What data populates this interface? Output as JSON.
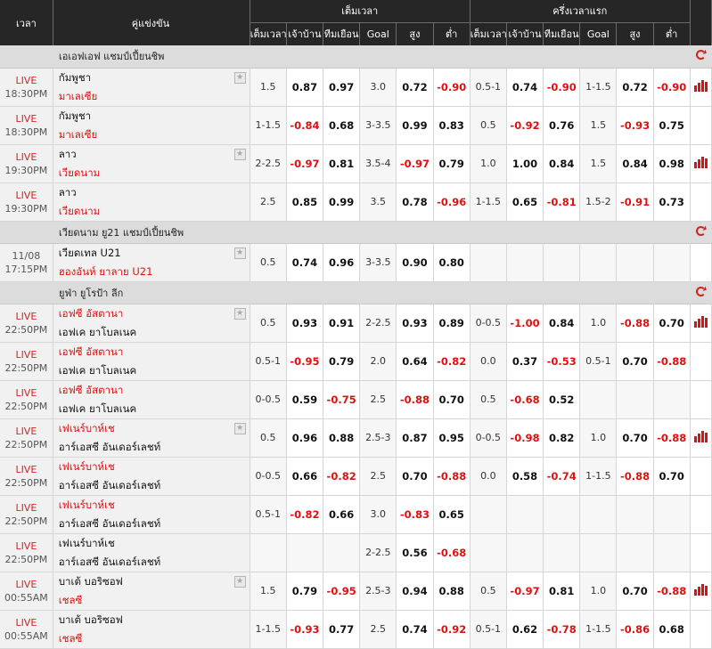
{
  "header": {
    "time": "เวลา",
    "match": "คู่แข่งขัน",
    "fulltime": "เต็มเวลา",
    "firsthalf": "ครึ่งเวลาแรก",
    "sub": [
      "เต็มเวลา",
      "เจ้าบ้าน",
      "ทีมเยือน",
      "Goal",
      "สูง",
      "ต่ำ",
      "เต็มเวลา",
      "เจ้าบ้าน",
      "ทีมเยือน",
      "Goal",
      "สูง",
      "ต่ำ"
    ]
  },
  "leagues": [
    {
      "name": "เอเอฟเอฟ แชมป์เปี้ยนชิพ",
      "rows": [
        {
          "status": "LIVE",
          "time": "18:30PM",
          "home": "กัมพูชา",
          "home_color": "black",
          "away": "มาเลเซีย",
          "away_color": "red",
          "star": true,
          "chart": true,
          "ft": [
            "1.5",
            "0.87",
            "0.97",
            "3.0",
            "0.72",
            "-0.90"
          ],
          "fh": [
            "0.5-1",
            "0.74",
            "-0.90",
            "1-1.5",
            "0.72",
            "-0.90"
          ]
        },
        {
          "status": "LIVE",
          "time": "18:30PM",
          "home": "กัมพูชา",
          "home_color": "black",
          "away": "มาเลเซีย",
          "away_color": "red",
          "star": false,
          "chart": false,
          "ft": [
            "1-1.5",
            "-0.84",
            "0.68",
            "3-3.5",
            "0.99",
            "0.83"
          ],
          "fh": [
            "0.5",
            "-0.92",
            "0.76",
            "1.5",
            "-0.93",
            "0.75"
          ]
        },
        {
          "status": "LIVE",
          "time": "19:30PM",
          "home": "ลาว",
          "home_color": "black",
          "away": "เวียดนาม",
          "away_color": "red",
          "star": true,
          "chart": true,
          "ft": [
            "2-2.5",
            "-0.97",
            "0.81",
            "3.5-4",
            "-0.97",
            "0.79"
          ],
          "fh": [
            "1.0",
            "1.00",
            "0.84",
            "1.5",
            "0.84",
            "0.98"
          ]
        },
        {
          "status": "LIVE",
          "time": "19:30PM",
          "home": "ลาว",
          "home_color": "black",
          "away": "เวียดนาม",
          "away_color": "red",
          "star": false,
          "chart": false,
          "ft": [
            "2.5",
            "0.85",
            "0.99",
            "3.5",
            "0.78",
            "-0.96"
          ],
          "fh": [
            "1-1.5",
            "0.65",
            "-0.81",
            "1.5-2",
            "-0.91",
            "0.73"
          ]
        }
      ]
    },
    {
      "name": "เวียดนาม ยู21 แชมป์เปี้ยนชิพ",
      "rows": [
        {
          "status": "11/08",
          "time": "17:15PM",
          "home": "เวียดเทล U21",
          "home_color": "black",
          "away": "ฮองอันห์ ยาลาย U21",
          "away_color": "red",
          "star": true,
          "chart": false,
          "ft": [
            "0.5",
            "0.74",
            "0.96",
            "3-3.5",
            "0.90",
            "0.80"
          ],
          "fh": [
            "",
            "",
            "",
            "",
            "",
            ""
          ]
        }
      ]
    },
    {
      "name": "ยูฟ่า ยูโรป้า ลีก",
      "rows": [
        {
          "status": "LIVE",
          "time": "22:50PM",
          "home": "เอฟซี อัสตานา",
          "home_color": "red",
          "away": "เอฟเค ยาโบลเนค",
          "away_color": "black",
          "star": true,
          "chart": true,
          "ft": [
            "0.5",
            "0.93",
            "0.91",
            "2-2.5",
            "0.93",
            "0.89"
          ],
          "fh": [
            "0-0.5",
            "-1.00",
            "0.84",
            "1.0",
            "-0.88",
            "0.70"
          ]
        },
        {
          "status": "LIVE",
          "time": "22:50PM",
          "home": "เอฟซี อัสตานา",
          "home_color": "red",
          "away": "เอฟเค ยาโบลเนค",
          "away_color": "black",
          "star": false,
          "chart": false,
          "ft": [
            "0.5-1",
            "-0.95",
            "0.79",
            "2.0",
            "0.64",
            "-0.82"
          ],
          "fh": [
            "0.0",
            "0.37",
            "-0.53",
            "0.5-1",
            "0.70",
            "-0.88"
          ]
        },
        {
          "status": "LIVE",
          "time": "22:50PM",
          "home": "เอฟซี อัสตานา",
          "home_color": "red",
          "away": "เอฟเค ยาโบลเนค",
          "away_color": "black",
          "star": false,
          "chart": false,
          "ft": [
            "0-0.5",
            "0.59",
            "-0.75",
            "2.5",
            "-0.88",
            "0.70"
          ],
          "fh": [
            "0.5",
            "-0.68",
            "0.52",
            "",
            "",
            ""
          ]
        },
        {
          "status": "LIVE",
          "time": "22:50PM",
          "home": "เฟเนร์บาห์เช",
          "home_color": "red",
          "away": "อาร์เอสซี อันเดอร์เลชท์",
          "away_color": "black",
          "star": true,
          "chart": true,
          "ft": [
            "0.5",
            "0.96",
            "0.88",
            "2.5-3",
            "0.87",
            "0.95"
          ],
          "fh": [
            "0-0.5",
            "-0.98",
            "0.82",
            "1.0",
            "0.70",
            "-0.88"
          ]
        },
        {
          "status": "LIVE",
          "time": "22:50PM",
          "home": "เฟเนร์บาห์เช",
          "home_color": "red",
          "away": "อาร์เอสซี อันเดอร์เลชท์",
          "away_color": "black",
          "star": false,
          "chart": false,
          "ft": [
            "0-0.5",
            "0.66",
            "-0.82",
            "2.5",
            "0.70",
            "-0.88"
          ],
          "fh": [
            "0.0",
            "0.58",
            "-0.74",
            "1-1.5",
            "-0.88",
            "0.70"
          ]
        },
        {
          "status": "LIVE",
          "time": "22:50PM",
          "home": "เฟเนร์บาห์เช",
          "home_color": "red",
          "away": "อาร์เอสซี อันเดอร์เลชท์",
          "away_color": "black",
          "star": false,
          "chart": false,
          "ft": [
            "0.5-1",
            "-0.82",
            "0.66",
            "3.0",
            "-0.83",
            "0.65"
          ],
          "fh": [
            "",
            "",
            "",
            "",
            "",
            ""
          ]
        },
        {
          "status": "LIVE",
          "time": "22:50PM",
          "home": "เฟเนร์บาห์เช",
          "home_color": "black",
          "away": "อาร์เอสซี อันเดอร์เลชท์",
          "away_color": "black",
          "star": false,
          "chart": false,
          "ft": [
            "",
            "",
            "",
            "2-2.5",
            "0.56",
            "-0.68"
          ],
          "fh": [
            "",
            "",
            "",
            "",
            "",
            ""
          ]
        },
        {
          "status": "LIVE",
          "time": "00:55AM",
          "home": "บาเต้ บอริซอฟ",
          "home_color": "black",
          "away": "เชลซี",
          "away_color": "red",
          "star": true,
          "chart": true,
          "ft": [
            "1.5",
            "0.79",
            "-0.95",
            "2.5-3",
            "0.94",
            "0.88"
          ],
          "fh": [
            "0.5",
            "-0.97",
            "0.81",
            "1.0",
            "0.70",
            "-0.88"
          ]
        },
        {
          "status": "LIVE",
          "time": "00:55AM",
          "home": "บาเต้ บอริซอฟ",
          "home_color": "black",
          "away": "เชลซี",
          "away_color": "red",
          "star": false,
          "chart": false,
          "ft": [
            "1-1.5",
            "-0.93",
            "0.77",
            "2.5",
            "0.74",
            "-0.92"
          ],
          "fh": [
            "0.5-1",
            "0.62",
            "-0.78",
            "1-1.5",
            "-0.86",
            "0.68"
          ]
        }
      ]
    }
  ],
  "colors": {
    "live": "#e02020",
    "negative": "#e01010",
    "header_bg": "#262626",
    "league_bg": "#dcdcdc"
  },
  "icons": {
    "star": "star-icon",
    "refresh": "refresh-icon",
    "chart": "bar-chart-icon"
  }
}
